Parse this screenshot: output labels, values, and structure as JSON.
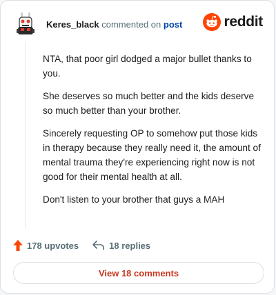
{
  "comment": {
    "username": "Keres_black",
    "verb": "commented on",
    "target": "post",
    "paragraphs": [
      "NTA, that poor girl dodged a major bullet thanks to you.",
      "She deserves so much better and the kids deserve so much better than your brother.",
      "Sincerely requesting OP to somehow put those kids in therapy because they really need it, the amount of mental trauma they're experiencing right now is not good for their mental health at all.",
      "Don't listen to your brother that guys a MAH"
    ]
  },
  "brand": {
    "name": "reddit",
    "icon": "reddit-logo-icon",
    "color": "#ff4500"
  },
  "actions": {
    "upvotes_label": "178 upvotes",
    "replies_label": "18 replies",
    "view_comments_label": "View 18 comments"
  },
  "colors": {
    "upvote": "#ff4500",
    "link": "#0045ac",
    "view_button_text": "#c8371e"
  }
}
